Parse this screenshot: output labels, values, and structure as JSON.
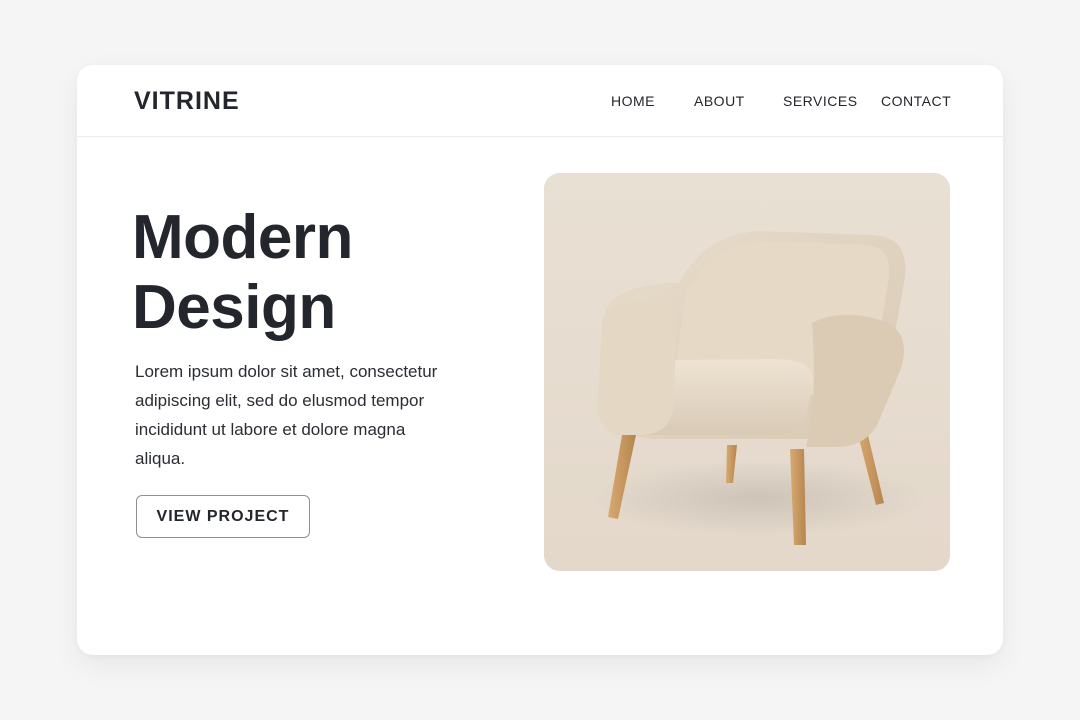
{
  "brand": {
    "name": "VITRINE"
  },
  "nav": {
    "items": [
      {
        "label": "HOME"
      },
      {
        "label": "ABOUT"
      },
      {
        "label": "SERVICES"
      },
      {
        "label": "CONTACT"
      }
    ]
  },
  "hero": {
    "headline_line1": "Modern",
    "headline_line2": "Design",
    "body": "Lorem ipsum dolor sit amet, consectetur adipiscing elit, sed do elusmod tempor incididunt ut labore et dolore magna aliqua.",
    "cta_label": "VIEW PROJECT",
    "image_icon": "armchair-image"
  },
  "colors": {
    "text": "#23262c",
    "card": "#ffffff",
    "background": "#f5f5f5",
    "image_background": "#e7ddd0",
    "chair_fabric": "#e3d6c4",
    "chair_legs": "#c99a63"
  }
}
